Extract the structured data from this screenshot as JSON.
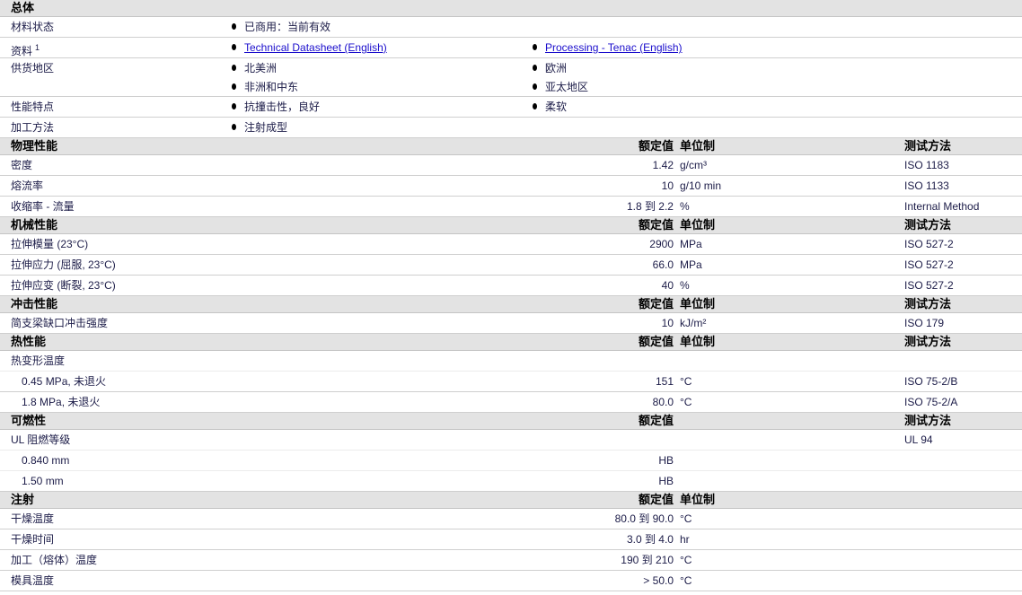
{
  "general": {
    "title": "总体",
    "rows": [
      {
        "label": "材料状态",
        "col1": [
          "已商用：当前有效"
        ],
        "col2": []
      },
      {
        "label": "资料",
        "sup": "1",
        "col1": [
          "Technical Datasheet (English)"
        ],
        "col2": [
          "Processing - Tenac (English)"
        ],
        "links": true
      },
      {
        "label": "供货地区",
        "col1": [
          "北美洲",
          "非洲和中东"
        ],
        "col2": [
          "欧洲",
          "亚太地区"
        ]
      },
      {
        "label": "性能特点",
        "col1": [
          "抗撞击性，良好"
        ],
        "col2": [
          "柔软"
        ]
      },
      {
        "label": "加工方法",
        "col1": [
          "注射成型"
        ],
        "col2": []
      }
    ]
  },
  "sections": [
    {
      "title": "物理性能",
      "h_value": "额定值",
      "h_unit": "单位制",
      "h_test": "测试方法",
      "rows": [
        {
          "label": "密度",
          "value": "1.42",
          "unit": "g/cm³",
          "test": "ISO 1183"
        },
        {
          "label": "熔流率",
          "value": "10",
          "unit": "g/10 min",
          "test": "ISO 1133"
        },
        {
          "label": "收缩率 - 流量",
          "value": "1.8 到  2.2",
          "unit": "%",
          "test": "Internal Method"
        }
      ]
    },
    {
      "title": "机械性能",
      "h_value": "额定值",
      "h_unit": "单位制",
      "h_test": "测试方法",
      "rows": [
        {
          "label": "拉伸模量 (23°C)",
          "value": "2900",
          "unit": "MPa",
          "test": "ISO 527-2"
        },
        {
          "label": "拉伸应力 (屈服, 23°C)",
          "value": "66.0",
          "unit": "MPa",
          "test": "ISO 527-2"
        },
        {
          "label": "拉伸应变 (断裂, 23°C)",
          "value": "40",
          "unit": "%",
          "test": "ISO 527-2"
        }
      ]
    },
    {
      "title": "冲击性能",
      "h_value": "额定值",
      "h_unit": "单位制",
      "h_test": "测试方法",
      "rows": [
        {
          "label": "简支梁缺口冲击强度",
          "value": "10",
          "unit": "kJ/m²",
          "test": "ISO 179"
        }
      ]
    },
    {
      "title": "热性能",
      "h_value": "额定值",
      "h_unit": "单位制",
      "h_test": "测试方法",
      "rows": [
        {
          "label": "热变形温度",
          "nb": true
        },
        {
          "label": "0.45 MPa, 未退火",
          "indent": true,
          "value": "151",
          "unit": "°C",
          "test": "ISO 75-2/B"
        },
        {
          "label": "1.8 MPa, 未退火",
          "indent": true,
          "value": "80.0",
          "unit": "°C",
          "test": "ISO 75-2/A"
        }
      ]
    },
    {
      "title": "可燃性",
      "h_value": "额定值",
      "h_test": "测试方法",
      "rows": [
        {
          "label": "UL 阻燃等级",
          "test": "UL 94",
          "nb": true
        },
        {
          "label": "0.840 mm",
          "indent": true,
          "value": "HB",
          "nb": true
        },
        {
          "label": "1.50 mm",
          "indent": true,
          "value": "HB"
        }
      ]
    },
    {
      "title": "注射",
      "h_value": "额定值",
      "h_unit": "单位制",
      "rows": [
        {
          "label": "干燥温度",
          "value": "80.0 到  90.0",
          "unit": "°C"
        },
        {
          "label": "干燥时间",
          "value": "3.0 到  4.0",
          "unit": "hr"
        },
        {
          "label": "加工（熔体）温度",
          "value": "190 到  210",
          "unit": "°C"
        },
        {
          "label": "模具温度",
          "value": "> 50.0",
          "unit": "°C"
        }
      ]
    }
  ]
}
